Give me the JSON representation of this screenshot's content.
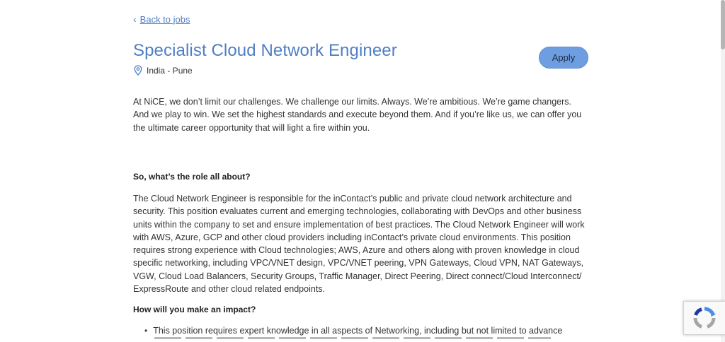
{
  "nav": {
    "back_label": "Back to jobs"
  },
  "job": {
    "title": "Specialist Cloud Network Engineer",
    "location": "India - Pune",
    "apply_label": "Apply"
  },
  "content": {
    "intro": "At NiCE, we don’t limit our challenges. We challenge our limits. Always. We’re ambitious. We’re game changers. And we play to win. We set the highest standards and execute beyond them. And if you’re like us, we can offer you the ultimate career opportunity that will light a fire within you.",
    "role_heading": "So, what’s the role all about?",
    "role_text": "The Cloud Network Engineer is responsible for the inContact’s public and private cloud network architecture and security. This position evaluates current and emerging technologies, collaborating with DevOps and other business units within the company to set and ensure implementation of best practices.  The Cloud Network Engineer will work with AWS, Azure, GCP and other cloud providers including inContact’s private cloud environments. This position requires strong experience with Cloud technologies; AWS, Azure and others along with proven knowledge in cloud specific networking, including VPC/VNET design, VPC/VNET peering, VPN Gateways, Cloud VPN, NAT Gateways, VGW, Cloud Load Balancers, Security Groups, Traffic Manager, Direct Peering, Direct connect/Cloud Interconnect/ ExpressRoute and other cloud related endpoints.",
    "impact_heading": "How will you make an impact?",
    "impact_items": [
      "This position requires expert knowledge in all aspects of Networking, including but not limited to advance"
    ]
  },
  "icons": {
    "back": "chevron-left-icon",
    "location": "map-pin-icon",
    "recaptcha": "recaptcha-logo-icon"
  },
  "colors": {
    "accent": "#4f7ec4",
    "apply_button": "#6e9ee0",
    "text": "#333333"
  }
}
